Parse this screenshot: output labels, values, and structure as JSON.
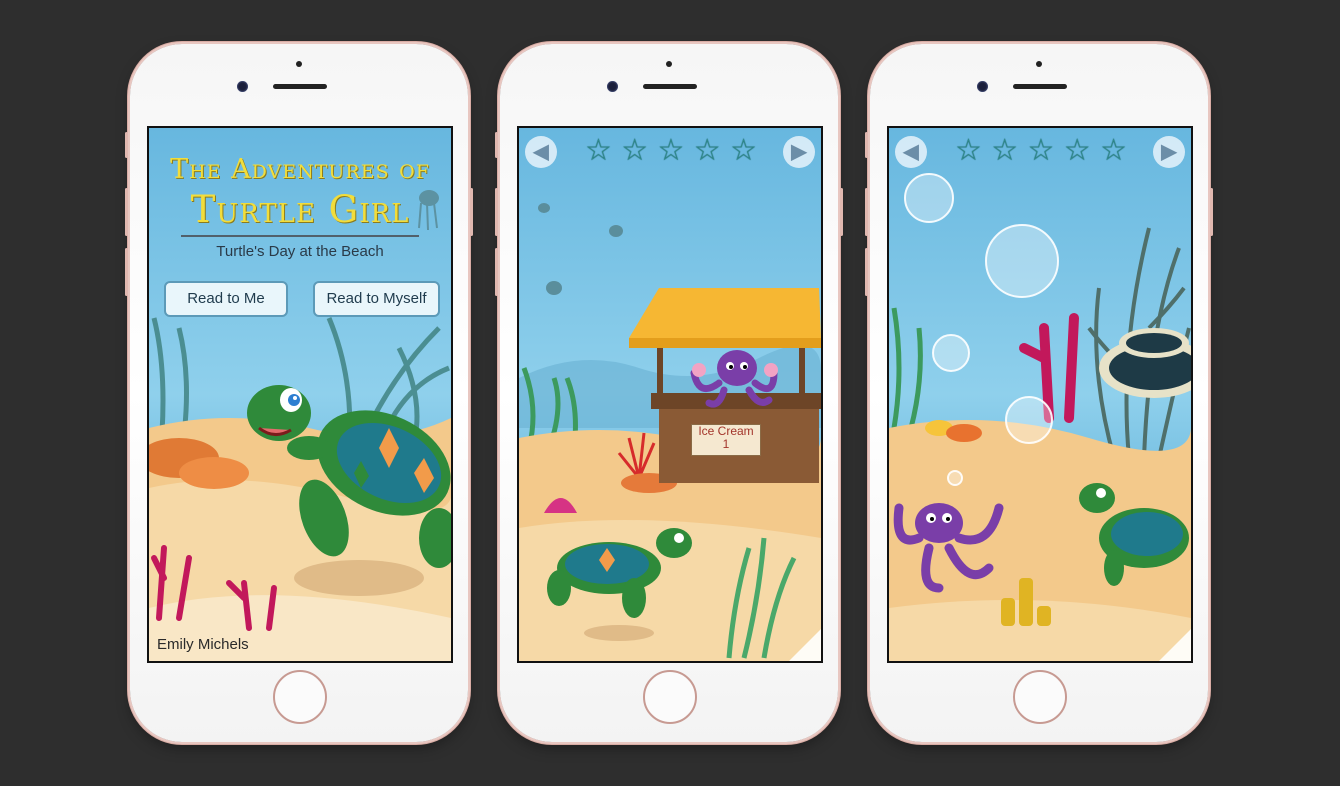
{
  "screens": [
    {
      "name": "cover",
      "title_line1": "The Adventures of",
      "title_line2": "Turtle Girl",
      "subtitle": "Turtle's Day at the Beach",
      "buttons": [
        "Read to Me",
        "Read to Myself"
      ],
      "author": "Emily Michels"
    },
    {
      "name": "ice-cream-stand",
      "nav": {
        "back_icon": "arrow-left-icon",
        "forward_icon": "arrow-right-icon",
        "back_glyph": "◀",
        "forward_glyph": "▶"
      },
      "stars": [
        "☆",
        "☆",
        "☆",
        "☆",
        "☆"
      ],
      "sign_line1": "Ice Cream",
      "sign_line2": "1"
    },
    {
      "name": "bubbles",
      "nav": {
        "back_icon": "arrow-left-icon",
        "forward_icon": "arrow-right-icon",
        "back_glyph": "◀",
        "forward_glyph": "▶"
      },
      "stars": [
        "☆",
        "☆",
        "☆",
        "☆",
        "☆"
      ]
    }
  ],
  "colors": {
    "background": "#2e2e2e",
    "phone_body": "#f7f7f7",
    "phone_trim": "#e1b8b0",
    "water": "#4aa6d3",
    "sand": "#f3c98b",
    "turtle_green": "#2f8a3a",
    "octopus_purple": "#7a3ea8",
    "title_yellow": "#f2dd3b"
  }
}
